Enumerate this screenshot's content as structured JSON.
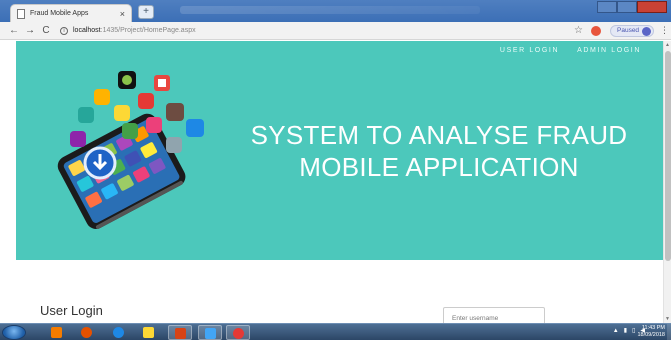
{
  "browser": {
    "tab_title": "Fraud Mobile Apps",
    "tab_close": "×",
    "new_tab": "+",
    "back_glyph": "←",
    "forward_glyph": "→",
    "reload_glyph": "C",
    "url_host": "localhost",
    "url_path": ":1435/Project/HomePage.aspx",
    "profile_status": "Paused",
    "profile_initial": "B",
    "star_glyph": "☆",
    "menu_glyph": "⋮"
  },
  "nav": {
    "user_login": "USER LOGIN",
    "admin_login": "ADMIN LOGIN"
  },
  "hero": {
    "title_line1": "SYSTEM TO ANALYSE FRAUD",
    "title_line2": "MOBILE APPLICATION",
    "background": "#4cc8bb"
  },
  "login": {
    "heading": "User Login",
    "username_placeholder": "Enter username"
  },
  "taskbar": {
    "time": "11:43 PM",
    "date": "18/09/2018",
    "tray_arrow": "▲"
  }
}
